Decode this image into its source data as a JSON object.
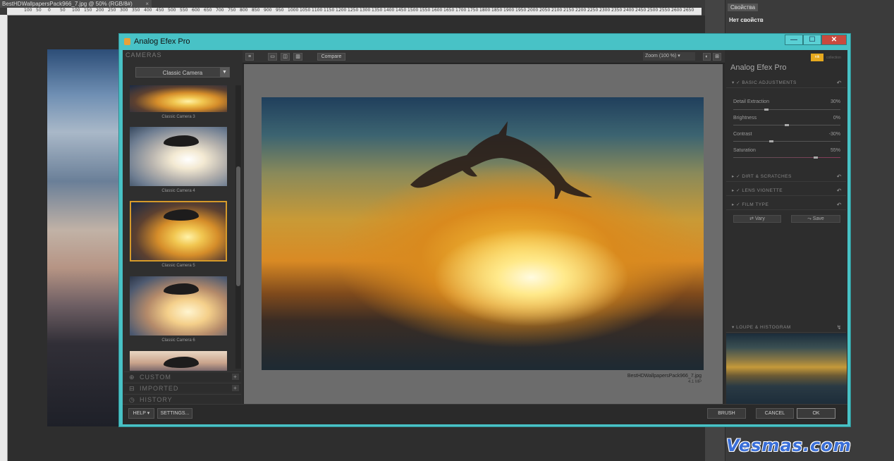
{
  "photoshop": {
    "doc_tab": "BestHDWallpapersPack966_7.jpg @ 50% (RGB/8#)",
    "ruler_ticks": [
      "100",
      "50",
      "0",
      "50",
      "100",
      "150",
      "200",
      "250",
      "300",
      "350",
      "400",
      "450",
      "500",
      "550",
      "600",
      "650",
      "700",
      "750",
      "800",
      "850",
      "900",
      "950",
      "1000",
      "1050",
      "1100",
      "1150",
      "1200",
      "1250",
      "1300",
      "1350",
      "1400",
      "1450",
      "1500",
      "1550",
      "1600",
      "1650",
      "1700",
      "1750",
      "1800",
      "1850",
      "1900",
      "1950",
      "2000",
      "2050",
      "2100",
      "2150",
      "2200",
      "2250",
      "2300",
      "2350",
      "2400",
      "2450",
      "2500",
      "2550",
      "2600",
      "2650"
    ],
    "properties_tab": "Свойства",
    "properties_empty": "Нет свойств"
  },
  "watermark": "Vesmas.com",
  "dialog": {
    "title": "Analog Efex Pro",
    "window_buttons": {
      "minimize": "—",
      "maximize": "☐",
      "close": "✕"
    }
  },
  "left_panel": {
    "cameras_header": "CAMERAS",
    "camera_select": "Classic Camera",
    "thumbnails": [
      {
        "caption": "Classic Camera 3"
      },
      {
        "caption": "Classic Camera 4"
      },
      {
        "caption": "Classic Camera 5",
        "selected": true
      },
      {
        "caption": "Classic Camera 6"
      },
      {
        "caption": ""
      }
    ],
    "sections": {
      "custom": "CUSTOM",
      "imported": "IMPORTED",
      "history": "HISTORY"
    }
  },
  "toolbar": {
    "compare": "Compare",
    "zoom": "Zoom (100 %)"
  },
  "preview": {
    "filename": "BestHDWallpapersPack966_7.jpg",
    "size": "4.1 MP"
  },
  "right_panel": {
    "logo": "nik",
    "logo_text": "collection",
    "title": "Analog Efex Pro",
    "basic_adjustments": "BASIC ADJUSTMENTS",
    "sliders": [
      {
        "label": "Detail Extraction",
        "value": "30%",
        "level": 0.3
      },
      {
        "label": "Brightness",
        "value": "0%",
        "level": 0.5
      },
      {
        "label": "Contrast",
        "value": "-30%",
        "level": 0.35
      },
      {
        "label": "Saturation",
        "value": "55%",
        "level": 0.78
      }
    ],
    "sections": {
      "dirt": "DIRT & SCRATCHES",
      "lens": "LENS VIGNETTE",
      "film": "FILM TYPE",
      "loupe": "LOUPE & HISTOGRAM"
    },
    "vary": "Vary",
    "save": "Save"
  },
  "bottom_bar": {
    "help": "HELP",
    "settings": "SETTINGS...",
    "brush": "BRUSH",
    "cancel": "CANCEL",
    "ok": "OK"
  },
  "colors": {
    "dialog_frame": "#48c2c6",
    "close": "#c94a3e",
    "selection": "#d69a2a"
  }
}
